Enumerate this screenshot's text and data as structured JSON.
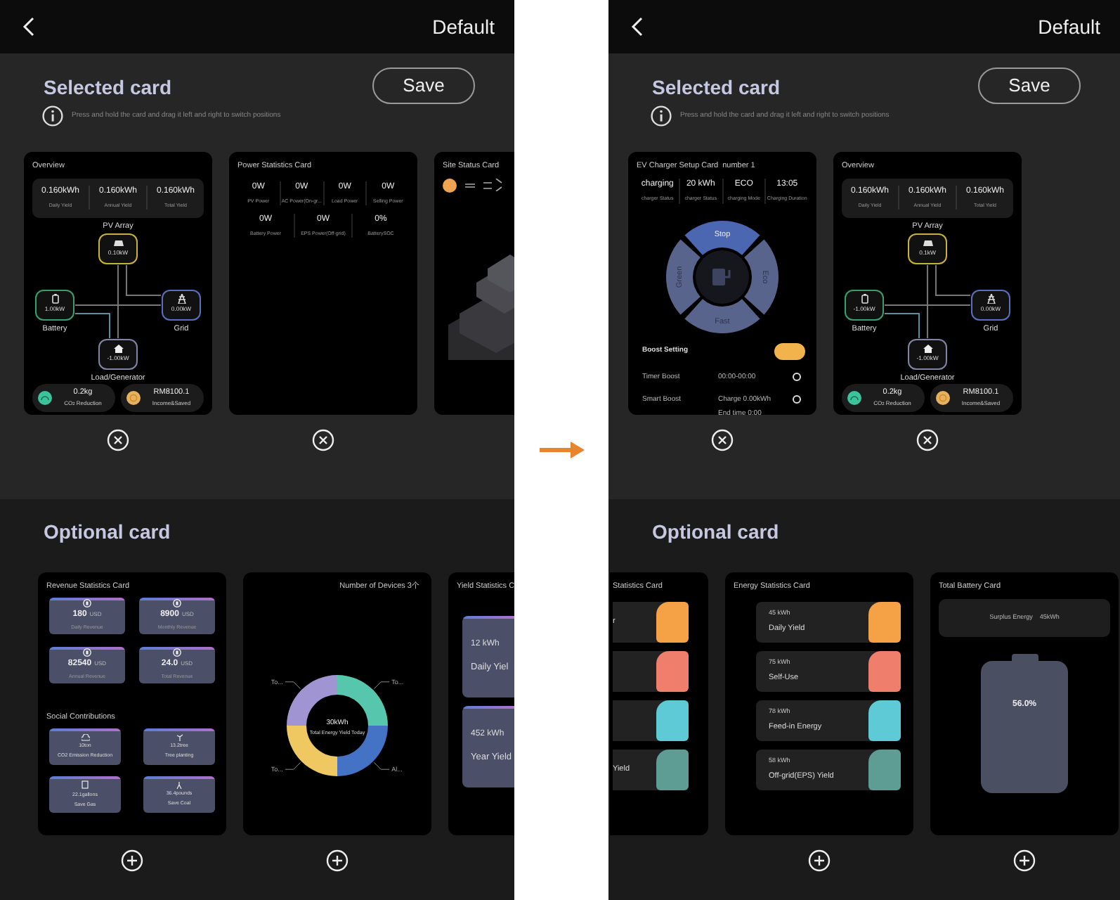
{
  "screens": [
    {
      "header": {
        "title": "Default"
      },
      "selected": {
        "title": "Selected card",
        "save": "Save",
        "hint": "Press and hold the card and drag it left and right to switch positions",
        "cards": [
          {
            "kind": "overview",
            "title": "Overview",
            "yields": [
              {
                "value": "0.160kWh",
                "label": "Daily Yield"
              },
              {
                "value": "0.160kWh",
                "label": "Annual Yield"
              },
              {
                "value": "0.160kWh",
                "label": "Total Yield"
              }
            ],
            "nodes": [
              {
                "kind": "pv",
                "label": "PV Array",
                "value": "0.10kW"
              },
              {
                "kind": "battery",
                "label": "Battery",
                "value": "1.00kW"
              },
              {
                "kind": "grid",
                "label": "Grid",
                "value": "0.00kW"
              },
              {
                "kind": "load",
                "label": "Load/Generator",
                "value": "-1.00kW"
              }
            ],
            "footer": [
              {
                "kind": "co2",
                "value": "0.2kg",
                "label": "CO$_{2}$ Reduction"
              },
              {
                "kind": "income",
                "value": "RM8100.1",
                "label": "Income&Saved"
              }
            ]
          },
          {
            "kind": "power_stats",
            "title": "Power Statistics Card",
            "rows": [
              {
                "items": [
                  {
                    "value": "0W",
                    "label": "PV Power"
                  },
                  {
                    "value": "0W",
                    "label": "AC Power(On-gr..."
                  },
                  {
                    "value": "0W",
                    "label": "Load Power"
                  },
                  {
                    "value": "0W",
                    "label": "Selling Power"
                  }
                ]
              },
              {
                "items": [
                  {
                    "value": "0W",
                    "label": "Battery Power"
                  },
                  {
                    "value": "0W",
                    "label": "EPS Power(Off-grid)"
                  },
                  {
                    "value": "0%",
                    "label": "BatterySOC"
                  }
                ]
              }
            ]
          },
          {
            "kind": "site_status",
            "title": "Site Status Card",
            "clipped": true
          }
        ]
      },
      "optional": {
        "title": "Optional card",
        "cards": [
          {
            "kind": "revenue",
            "title": "Revenue Statistics Card",
            "tiles": [
              {
                "value": "180",
                "unit": "USD",
                "label": "Daily Revenue"
              },
              {
                "value": "8900",
                "unit": "USD",
                "label": "Monthly Revenue"
              },
              {
                "value": "82540",
                "unit": "USD",
                "label": "Annual Revenue"
              },
              {
                "value": "24.0",
                "unit": "USD",
                "label": "Total Revenue"
              }
            ],
            "social_title": "Social Contributions",
            "social": [
              {
                "kind": "cloud",
                "value": "10ton",
                "label": "CO2 Emission Reduction"
              },
              {
                "kind": "tree",
                "value": "13.2tree",
                "label": "Tree planting"
              },
              {
                "kind": "gas",
                "value": "22.1gallons",
                "label": "Save Gas"
              },
              {
                "kind": "coal",
                "value": "36.4pounds",
                "label": "Save Coal"
              }
            ]
          },
          {
            "kind": "donut",
            "header": "Number of Devices 3个",
            "center_value": "30kWh",
            "center_label": "Total Energy Yield Today",
            "slices": [
              {
                "label": "To...",
                "color": "#a194d3"
              },
              {
                "label": "To...",
                "color": "#56c6ad"
              },
              {
                "label": "To...",
                "color": "#f0c862"
              },
              {
                "label": "Al...",
                "color": "#4472c4"
              }
            ]
          },
          {
            "kind": "yield_stats",
            "title": "Yield Statistics C",
            "clipped": true,
            "tiles": [
              {
                "value": "12 kWh",
                "label": "Daily Yiel"
              },
              {
                "value": "452 kWh",
                "label": "Year Yield"
              }
            ]
          }
        ]
      }
    },
    {
      "header": {
        "title": "Default"
      },
      "selected": {
        "title": "Selected card",
        "save": "Save",
        "hint": "Press and hold the card and drag it left and right to switch positions",
        "cards": [
          {
            "kind": "ev_charger",
            "title": "EV Charger Setup Card",
            "number": "number 1",
            "stats": [
              {
                "value": "charging",
                "label": "charger Status"
              },
              {
                "value": "20 kWh",
                "label": "charger Status"
              },
              {
                "value": "ECO",
                "label": "charging Mode"
              },
              {
                "value": "13:05",
                "label": "Charging Duration"
              }
            ],
            "pad": [
              {
                "label": "Stop",
                "selected": true
              },
              {
                "label": "Eco",
                "selected": false
              },
              {
                "label": "Fast",
                "selected": false
              },
              {
                "label": "Green",
                "selected": false
              }
            ],
            "boost_label": "Boost Setting",
            "boost_on": true,
            "options": [
              {
                "label": "Timer Boost",
                "lines": [
                  "00:00-00:00"
                ],
                "checked": false
              },
              {
                "label": "Smart Boost",
                "lines": [
                  "Charge 0.00kWh",
                  "End time 0:00"
                ],
                "checked": false
              }
            ]
          },
          {
            "kind": "overview",
            "title": "Overview",
            "yields": [
              {
                "value": "0.160kWh",
                "label": "Daily Yield"
              },
              {
                "value": "0.160kWh",
                "label": "Annual Yield"
              },
              {
                "value": "0.160kWh",
                "label": "Total Yield"
              }
            ],
            "nodes": [
              {
                "kind": "pv",
                "label": "PV Array",
                "value": "0.1kW"
              },
              {
                "kind": "battery",
                "label": "Battery",
                "value": "-1.00kW"
              },
              {
                "kind": "grid",
                "label": "Grid",
                "value": "0.00kW"
              },
              {
                "kind": "load",
                "label": "Load/Generator",
                "value": "-1.00kW"
              }
            ],
            "footer": [
              {
                "kind": "co2",
                "value": "0.2kg",
                "label": "CO$_{2}$ Reduction"
              },
              {
                "kind": "income",
                "value": "RM8100.1",
                "label": "Income&Saved"
              }
            ]
          }
        ]
      },
      "optional": {
        "title": "Optional card",
        "cards": [
          {
            "kind": "energy_stats",
            "title": "Statistics Card",
            "clipped": true,
            "rows": [
              {
                "label": "r",
                "color": "#f5a247"
              },
              {
                "color": "#ef7e6c"
              },
              {
                "color": "#5ecad6"
              },
              {
                "label": "Yield",
                "color": "#5e9d94"
              }
            ]
          },
          {
            "kind": "energy_stats",
            "title": "Energy Statistics Card",
            "rows": [
              {
                "value": "45 kWh",
                "label": "Daily Yield",
                "color": "#f5a247"
              },
              {
                "value": "75 kWh",
                "label": "Self-Use",
                "color": "#ef7e6c"
              },
              {
                "value": "78 kWh",
                "label": "Feed-in Energy",
                "color": "#5ecad6"
              },
              {
                "value": "58 kWh",
                "label": "Off-grid(EPS) Yield",
                "color": "#5e9d94"
              }
            ]
          },
          {
            "kind": "total_battery",
            "title": "Total Battery Card",
            "surplus_label": "Surplus Energy",
            "surplus_value": "45kWh",
            "reading": "56.0%"
          }
        ]
      }
    }
  ]
}
